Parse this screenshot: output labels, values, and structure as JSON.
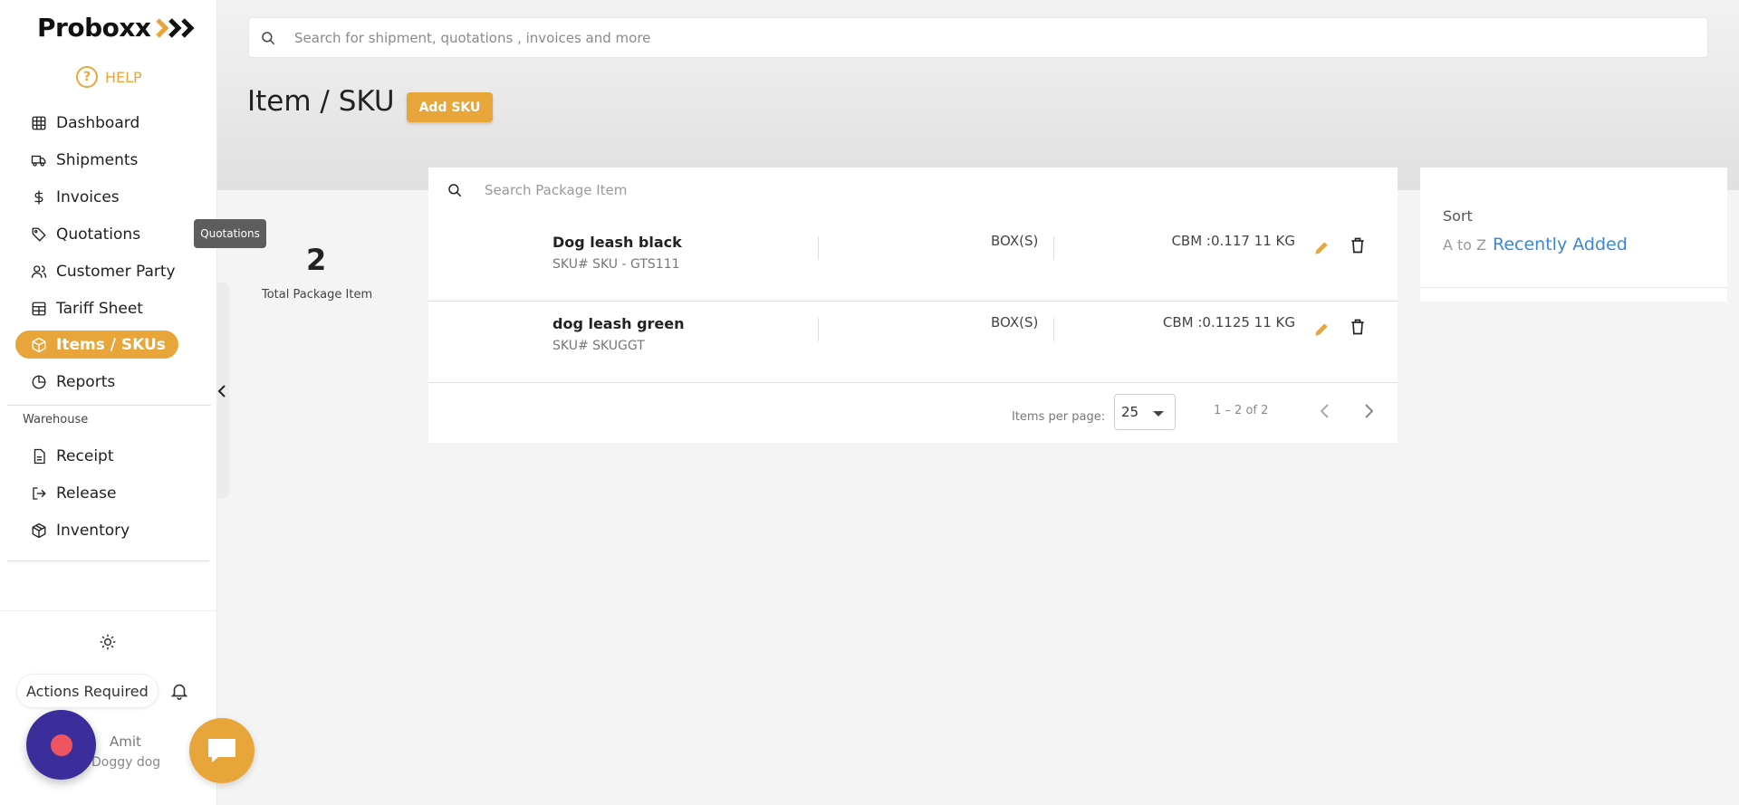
{
  "brand": {
    "logo_text": "Proboxx",
    "accent": "#e8a63a"
  },
  "help": {
    "label": "HELP",
    "glyph": "?"
  },
  "sidebar": {
    "items": [
      {
        "label": "Dashboard",
        "icon": "grid-icon"
      },
      {
        "label": "Shipments",
        "icon": "truck-icon"
      },
      {
        "label": "Invoices",
        "icon": "dollar-icon"
      },
      {
        "label": "Quotations",
        "icon": "tag-icon"
      },
      {
        "label": "Customer Party",
        "icon": "users-icon"
      },
      {
        "label": "Tariff Sheet",
        "icon": "table-icon"
      },
      {
        "label": "Items / SKUs",
        "icon": "package-icon",
        "active": true
      },
      {
        "label": "Reports",
        "icon": "pie-chart-icon"
      }
    ],
    "warehouse_label": "Warehouse",
    "warehouse_items": [
      {
        "label": "Receipt",
        "icon": "file-icon"
      },
      {
        "label": "Release",
        "icon": "logout-icon"
      },
      {
        "label": "Inventory",
        "icon": "box-icon"
      }
    ],
    "actions_required": "Actions Required",
    "user": {
      "name": "Amit",
      "company": "Doggy dog"
    }
  },
  "tooltip": "Quotations",
  "global_search": {
    "placeholder": "Search for shipment, quotations , invoices and more"
  },
  "page": {
    "title": "Item / SKU",
    "add_button": "Add SKU"
  },
  "stats": {
    "total": "2",
    "label": "Total Package Item"
  },
  "list": {
    "search_placeholder": "Search Package Item",
    "rows": [
      {
        "name": "Dog leash black",
        "sku": "SKU# SKU - GTS111",
        "unit": "BOX(S)",
        "cbm": "CBM :0.117  11 KG"
      },
      {
        "name": "dog leash green",
        "sku": "SKU# SKUGGT",
        "unit": "BOX(S)",
        "cbm": "CBM :0.1125  11 KG"
      }
    ],
    "pager": {
      "label": "Items per page:",
      "per_page": "25",
      "range": "1 – 2 of 2"
    }
  },
  "sort": {
    "title": "Sort",
    "az": "A to Z",
    "recent": "Recently Added"
  }
}
